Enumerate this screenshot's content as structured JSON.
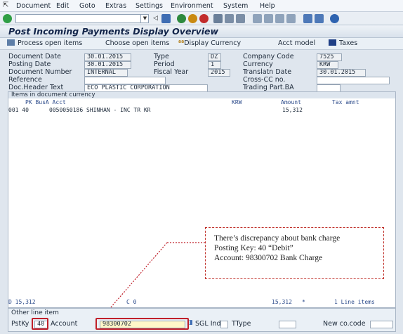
{
  "menu": {
    "items": [
      "Document",
      "Edit",
      "Goto",
      "Extras",
      "Settings",
      "Environment",
      "System",
      "Help"
    ]
  },
  "toolbar": {
    "icons": [
      "enter-icon",
      "save-icon",
      "back-icon",
      "exit-icon",
      "cancel-icon",
      "print-icon",
      "find-icon",
      "find-next-icon",
      "first-page-icon",
      "prev-page-icon",
      "next-page-icon",
      "last-page-icon",
      "new-session-icon",
      "shortcut-icon",
      "help-icon"
    ]
  },
  "title": "Post Incoming Payments Display Overview",
  "app_toolbar": {
    "process_open_items": "Process open items",
    "choose_open_items": "Choose open items",
    "display_currency": "Display Currency",
    "acct_model": "Acct model",
    "taxes": "Taxes"
  },
  "header": {
    "document_date": {
      "label": "Document Date",
      "value": "30.01.2015"
    },
    "type": {
      "label": "Type",
      "value": "DZ"
    },
    "company_code": {
      "label": "Company Code",
      "value": "7525"
    },
    "posting_date": {
      "label": "Posting Date",
      "value": "30.01.2015"
    },
    "period": {
      "label": "Period",
      "value": "1"
    },
    "currency": {
      "label": "Currency",
      "value": "KRW"
    },
    "document_number": {
      "label": "Document Number",
      "value": "INTERNAL"
    },
    "fiscal_year": {
      "label": "Fiscal Year",
      "value": "2015"
    },
    "translatn_date": {
      "label": "Translatn Date",
      "value": "30.01.2015"
    },
    "reference": {
      "label": "Reference",
      "value": ""
    },
    "cross_cc": {
      "label": "Cross-CC no.",
      "value": ""
    },
    "doc_header_text": {
      "label": "Doc.Header Text",
      "value": "ECO PLASTIC CORPORATION"
    },
    "trading_part": {
      "label": "Trading Part.BA",
      "value": ""
    }
  },
  "items": {
    "section_title": "Items in document currency",
    "columns": {
      "pk_busa_acct": "PK  BusA Acct",
      "krw": "KRW",
      "amount": "Amount",
      "tax_amnt": "Tax amnt"
    },
    "rows": [
      {
        "line": "001 40",
        "acct": "0050050186 SHINHAN - INC TR KR",
        "amount": "15,312"
      }
    ],
    "footer": {
      "debit": "D 15,312",
      "credit": "C 0",
      "total": "15,312",
      "star": "*",
      "line_items": "1 Line items"
    }
  },
  "other_line": {
    "title": "Other line item",
    "pstky_label": "PstKy",
    "pstky_value": "40",
    "account_label": "Account",
    "account_value": "98300702",
    "sgl_ind_label": "SGL Ind",
    "ttype_label": "TType",
    "new_cocode_label": "New co.code",
    "new_cocode_value": ""
  },
  "annotation": {
    "line1": "There’s discrepancy about bank charge",
    "line2": "Posting Key: 40 “Debit”",
    "line3": "Account: 98300702 Bank Charge"
  },
  "colors": {
    "highlight_red": "#c0202a",
    "title_navy": "#13254a",
    "header_blue": "#2b4a8a"
  }
}
